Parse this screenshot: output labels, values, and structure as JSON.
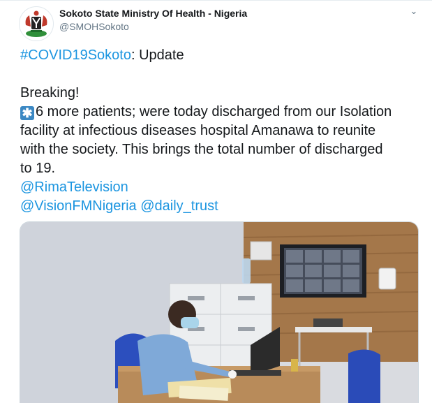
{
  "account": {
    "name": "Sokoto State Ministry Of Health - Nigeria",
    "handle": "@SMOHSokoto"
  },
  "tweet": {
    "hashtag": "#COVID19Sokoto",
    "update": ": Update",
    "breaking": "Breaking!",
    "keycap": "✱",
    "body_line1": "6 more patients; were today discharged from our Isolation",
    "body_line2": "facility at infectious diseases hospital Amanawa to reunite",
    "body_line3": "with the society. This brings the total number of discharged",
    "body_line4": "to 19.",
    "mention1": "@RimaTelevision",
    "mention2": "@VisionFMNigeria",
    "mention3": "@daily_trust"
  },
  "icons": {
    "caret": "chevron-down-icon",
    "avatar": "nigeria-coat-of-arms-logo",
    "keycap": "asterisk-keycap-emoji"
  },
  "colors": {
    "link": "#1b95e0",
    "text": "#14171a",
    "muted": "#657786",
    "keycap": "#3b88c3"
  }
}
